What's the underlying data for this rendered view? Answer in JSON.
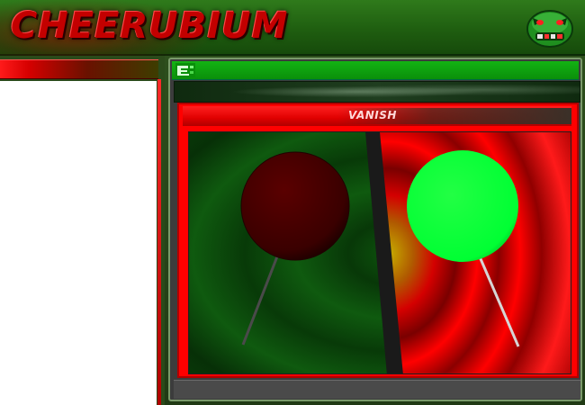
{
  "header": {
    "title": "CHEERUBIUM",
    "mascot_icon": "green-creature-face-icon"
  },
  "left_panel": {
    "bar_color_start": "#ff1a1a",
    "bar_color_end": "#3d3d00"
  },
  "right_panel": {
    "toolbar_icon": "green-corner-icon",
    "view_title": "VANISH"
  },
  "scene": {
    "left_lollipop": {
      "color": "#3a0000",
      "state": "dim"
    },
    "right_lollipop": {
      "color": "#00ff33",
      "state": "lit"
    }
  },
  "colors": {
    "accent_red": "#ff0000",
    "accent_green": "#13b313",
    "dark_green": "#0b3a0b"
  }
}
